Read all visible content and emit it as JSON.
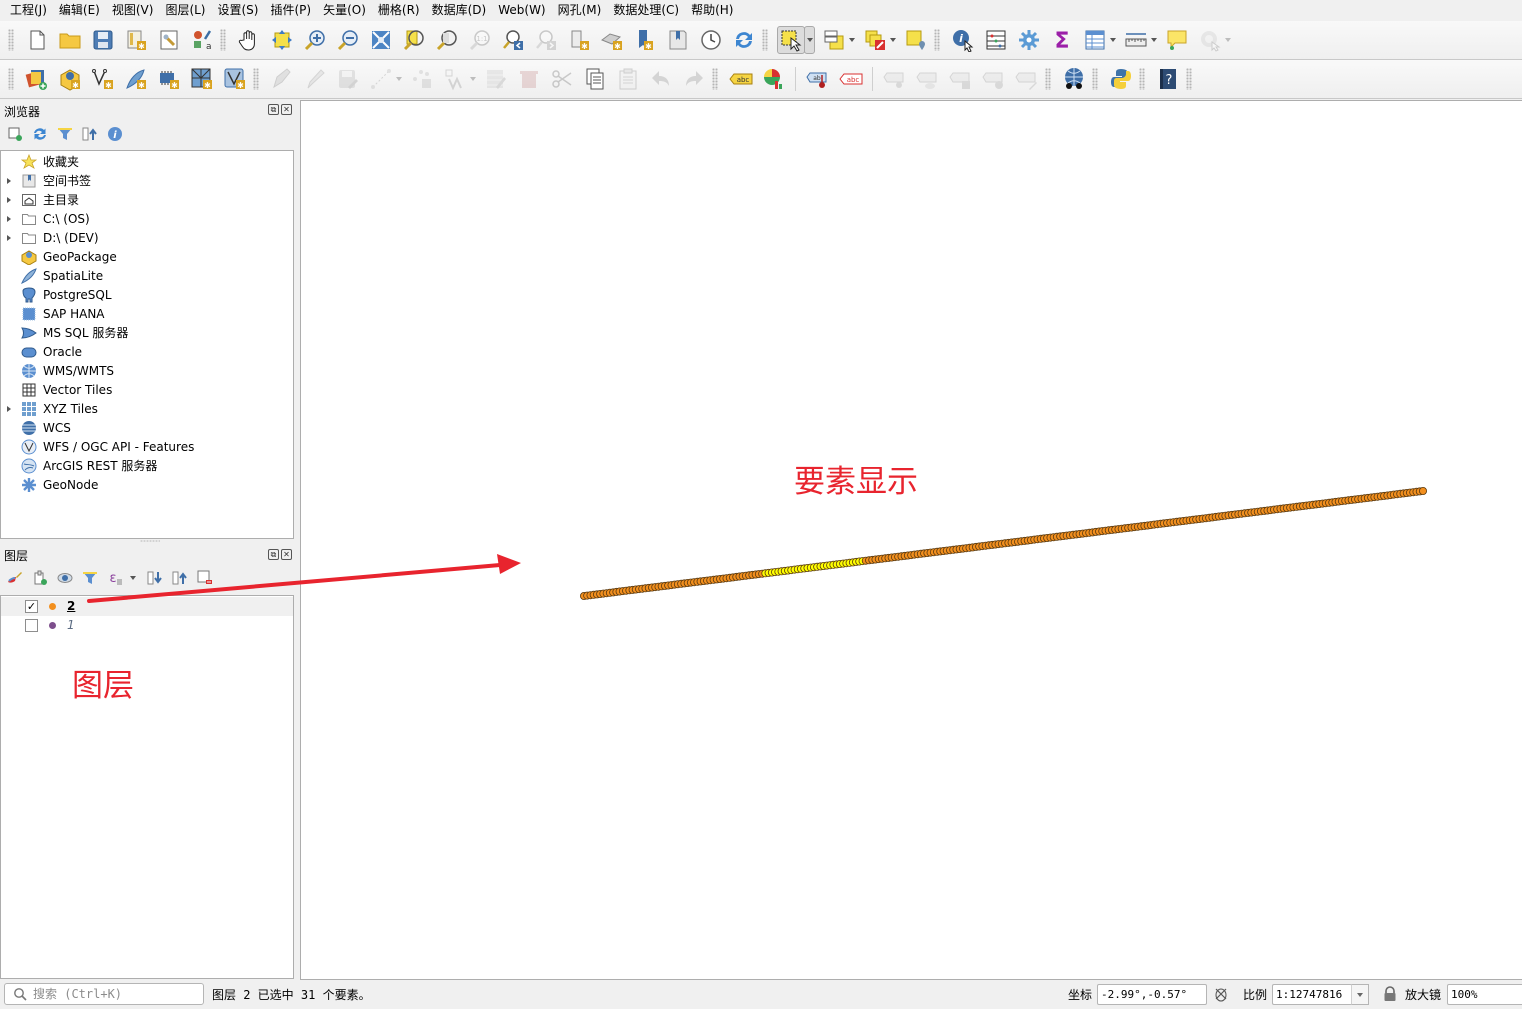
{
  "menubar": {
    "items": [
      "工程(J)",
      "编辑(E)",
      "视图(V)",
      "图层(L)",
      "设置(S)",
      "插件(P)",
      "矢量(O)",
      "栅格(R)",
      "数据库(D)",
      "Web(W)",
      "网孔(M)",
      "数据处理(C)",
      "帮助(H)"
    ]
  },
  "toolbar1": {
    "icons": [
      "new-project",
      "open-project",
      "save-project",
      "new-print-layout",
      "layout-manager",
      "style-manager",
      "pan-map",
      "pan-to-selection",
      "zoom-in",
      "zoom-out",
      "zoom-full",
      "zoom-to-selection",
      "zoom-to-layer",
      "zoom-to-native-resolution",
      "zoom-last",
      "zoom-next",
      "new-map-view",
      "new-3d-map-view",
      "new-spatial-bookmark",
      "show-spatial-bookmarks",
      "temporal-controller",
      "refresh",
      "select-features",
      "select-by-value",
      "deselect",
      "select-by-location",
      "identify-features",
      "attribute-table-open",
      "field-calculator",
      "statistical-summary",
      "open-attribute-table",
      "measure-line",
      "map-tips",
      "actions"
    ]
  },
  "toolbar2": {
    "icons": [
      "data-source-manager",
      "new-geopackage-layer",
      "new-shapefile-layer",
      "new-spatialite-layer",
      "new-virtual-layer",
      "new-mesh-layer",
      "new-vector-tile-layer",
      "current-edits",
      "toggle-editing",
      "save-layer-edits",
      "digitize",
      "vertex-tool",
      "modify-attributes",
      "delete-selected",
      "cut-features",
      "copy-features",
      "paste-features",
      "undo",
      "redo",
      "label-tool",
      "diagram-tool",
      "pin-labels",
      "highlight-pinned",
      "show-hide-labels",
      "move-label",
      "rotate-label",
      "change-label",
      "metasearch",
      "python-console",
      "help"
    ]
  },
  "browser": {
    "title": "浏览器",
    "items": [
      {
        "label": "收藏夹",
        "icon": "star-icon",
        "expandable": false
      },
      {
        "label": "空间书签",
        "icon": "bookmark-icon",
        "expandable": true
      },
      {
        "label": "主目录",
        "icon": "home-folder-icon",
        "expandable": true
      },
      {
        "label": "C:\\ (OS)",
        "icon": "folder-icon",
        "expandable": true
      },
      {
        "label": "D:\\ (DEV)",
        "icon": "folder-icon",
        "expandable": true
      },
      {
        "label": "GeoPackage",
        "icon": "geopackage-icon",
        "expandable": false
      },
      {
        "label": "SpatiaLite",
        "icon": "spatialite-feather-icon",
        "expandable": false
      },
      {
        "label": "PostgreSQL",
        "icon": "postgresql-elephant-icon",
        "expandable": false
      },
      {
        "label": "SAP HANA",
        "icon": "sap-hana-icon",
        "expandable": false
      },
      {
        "label": "MS SQL 服务器",
        "icon": "mssql-icon",
        "expandable": false
      },
      {
        "label": "Oracle",
        "icon": "oracle-icon",
        "expandable": false
      },
      {
        "label": "WMS/WMTS",
        "icon": "wms-globe-icon",
        "expandable": false
      },
      {
        "label": "Vector Tiles",
        "icon": "vector-tiles-grid-icon",
        "expandable": false
      },
      {
        "label": "XYZ Tiles",
        "icon": "xyz-tiles-icon",
        "expandable": true
      },
      {
        "label": "WCS",
        "icon": "wcs-globe-icon",
        "expandable": false
      },
      {
        "label": "WFS / OGC API - Features",
        "icon": "wfs-globe-icon",
        "expandable": false
      },
      {
        "label": "ArcGIS REST 服务器",
        "icon": "arcgis-globe-icon",
        "expandable": false
      },
      {
        "label": "GeoNode",
        "icon": "geonode-icon",
        "expandable": false
      }
    ]
  },
  "layers": {
    "title": "图层",
    "items": [
      {
        "name": "2",
        "checked": true,
        "color": "#f28f1e",
        "selected": true
      },
      {
        "name": "1",
        "checked": false,
        "color": "#7d4e8c",
        "selected": false
      }
    ]
  },
  "annotations": {
    "layers_label": "图层",
    "feature_label": "要素显示",
    "color": "#e8242e"
  },
  "map": {
    "point_fill": "#f28f1e",
    "selected_fill": "#ffff00",
    "point_stroke": "#5a3a10",
    "point_count": 260,
    "selected_count": 31
  },
  "statusbar": {
    "search_placeholder": "搜索 (Ctrl+K)",
    "message": "图层 2 已选中 31 个要素。",
    "coord_label": "坐标",
    "coord_value": "-2.99°,-0.57°",
    "scale_label": "比例",
    "scale_value": "1:12747816",
    "magnifier_label": "放大镜",
    "magnifier_value": "100%"
  }
}
